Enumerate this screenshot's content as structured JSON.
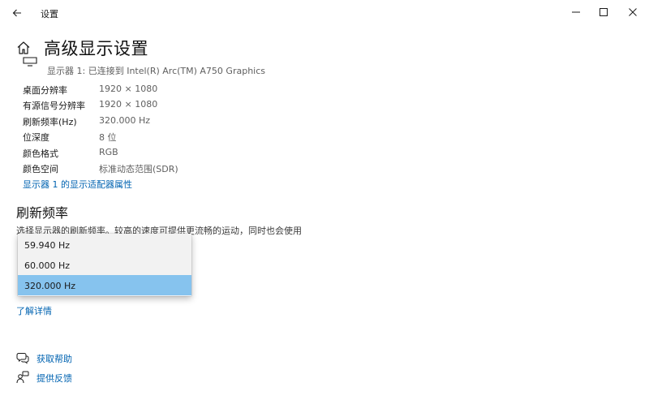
{
  "window": {
    "title": "设置",
    "controls": {
      "minimize": "minimize-icon",
      "maximize": "maximize-icon",
      "close": "close-icon"
    }
  },
  "page": {
    "title": "高级显示设置",
    "display_caption": "显示器 1: 已连接到 Intel(R) Arc(TM) A750 Graphics",
    "info": [
      {
        "label": "桌面分辨率",
        "value": "1920 × 1080"
      },
      {
        "label": "有源信号分辨率",
        "value": "1920 × 1080"
      },
      {
        "label": "刷新频率(Hz)",
        "value": "320.000 Hz"
      },
      {
        "label": "位深度",
        "value": "8 位"
      },
      {
        "label": "颜色格式",
        "value": "RGB"
      },
      {
        "label": "颜色空间",
        "value": "标准动态范围(SDR)"
      }
    ],
    "adapter_link": "显示器 1 的显示适配器属性"
  },
  "refresh": {
    "heading": "刷新频率",
    "description": "选择显示器的刷新频率。较高的速度可提供更流畅的运动，同时也会使用",
    "options": [
      "59.940 Hz",
      "60.000 Hz",
      "320.000 Hz"
    ],
    "selected": "320.000 Hz",
    "learn_more": "了解详情"
  },
  "help": {
    "get_help": "获取帮助",
    "feedback": "提供反馈"
  },
  "colors": {
    "accent": "#0063b1",
    "selection": "#86c3ee"
  }
}
